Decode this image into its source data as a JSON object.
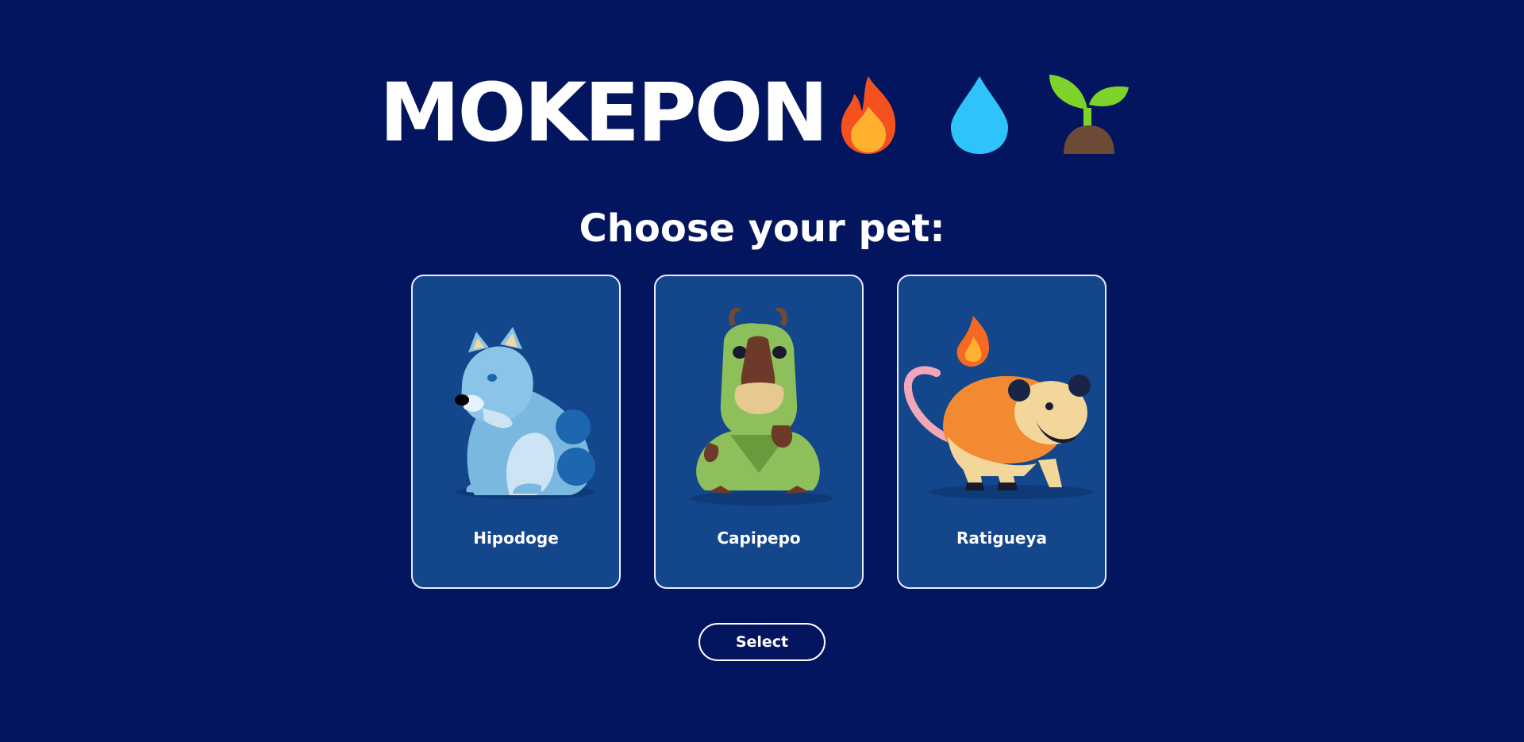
{
  "header": {
    "title": "MOKEPON",
    "icons": [
      "fire-icon",
      "water-drop-icon",
      "seedling-icon"
    ]
  },
  "subtitle": "Choose your pet:",
  "pets": [
    {
      "name": "Hipodoge",
      "icon": "hipodoge-illustration"
    },
    {
      "name": "Capipepo",
      "icon": "capipepo-illustration"
    },
    {
      "name": "Ratigueya",
      "icon": "ratigueya-illustration"
    }
  ],
  "select_button": {
    "label": "Select"
  },
  "colors": {
    "background": "#04155f",
    "card_background": "#14468c",
    "card_border": "#e8ecff",
    "text": "#ffffff",
    "fire": "#f7922f",
    "water": "#2ec4fb",
    "plant": "#7ed32a"
  }
}
